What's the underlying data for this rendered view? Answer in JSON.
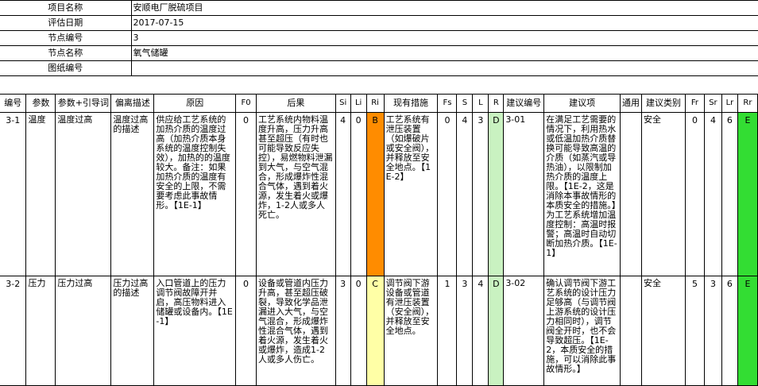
{
  "info": {
    "project_name_label": "项目名称",
    "project_name": "安顺电厂脱硫项目",
    "eval_date_label": "评估日期",
    "eval_date": "2017-07-15",
    "node_no_label": "节点编号",
    "node_no": "3",
    "node_name_label": "节点名称",
    "node_name": "氧气储罐",
    "drawing_no_label": "图纸编号",
    "drawing_no": ""
  },
  "headers": [
    "编号",
    "参数",
    "参数+引导词",
    "偏离描述",
    "原因",
    "F0",
    "后果",
    "Si",
    "Li",
    "Ri",
    "现有措施",
    "Fs",
    "S",
    "L",
    "R",
    "建议编号",
    "建议项",
    "通用",
    "建议类别",
    "Fr",
    "Sr",
    "Lr",
    "Rr"
  ],
  "rows": [
    {
      "id": "3-1",
      "param": "温度",
      "param_guide": "温度过高",
      "deviation": "温度过高的描述",
      "cause": "供应给工艺系统的加热介质的温度过高（加热介质本身系统的温度控制失效），加热的的温度较大。备注：如果加热介质的温度有安全的上限，不需要考虑此事故情形。【1E-1】",
      "f0": "0",
      "consequence": "工艺系统内物料温度升高，压力升高甚至超压（有时也可能导致反应失控），易燃物料泄漏到大气，与空气混合，形成爆炸性混合气体，遇到着火源，发生着火或爆炸，1-2人或多人死亡。",
      "si": "4",
      "li": "0",
      "ri": "B",
      "existing": "工艺系统有泄压装置（如爆破片或安全阀），并释放至安全地点。【1E-2】",
      "fs": "0",
      "s": "4",
      "l": "3",
      "r": "D",
      "rec_no": "3-01",
      "recommendation": "在满足工艺需要的情况下，利用热水或低温加热介质替换可能导致高温的介质（如蒸汽或导热油），以限制加热介质的温度上限。【1E-2，这是消除本事故情形的本质安全的措施。】为工艺系统增加温度控制：高温时报警；高温时自动切断加热介质。【1E-1】",
      "general": "",
      "rec_type": "安全",
      "fr": "0",
      "sr": "4",
      "lr": "6",
      "rr": "E"
    },
    {
      "id": "3-2",
      "param": "压力",
      "param_guide": "压力过高",
      "deviation": "压力过高的描述",
      "cause": "入口管道上的压力调节阀故障开并启，高压物料进入储罐或设备内。【1E-1】",
      "f0": "0",
      "consequence": "设备或管道内压力升高，甚至超压破裂，导致化学品泄漏进入大气，与空气混合，形成爆炸性混合气体，遇到着火源，发生着火或爆炸，造成1-2人或多人伤亡。",
      "si": "3",
      "li": "0",
      "ri": "C",
      "existing": "调节阀下游设备或管道有泄压装置（安全阀），并释放至安全地点。",
      "fs": "1",
      "s": "3",
      "l": "4",
      "r": "D",
      "rec_no": "3-02",
      "recommendation": "确认调节阀下游工艺系统的设计压力足够高（与调节阀上游系统的设计压力相同时），调节阀全开时，也不会导致超压。【1E-2，本质安全的措施，可以消除此事故情形。】",
      "general": "",
      "rec_type": "安全",
      "fr": "5",
      "sr": "3",
      "lr": "6",
      "rr": "E"
    }
  ],
  "colors": {
    "ri_B": "#ff8c00",
    "ri_C": "#ffffa6",
    "r_D": "#c9f2c1",
    "rr_E": "#33dd33"
  }
}
